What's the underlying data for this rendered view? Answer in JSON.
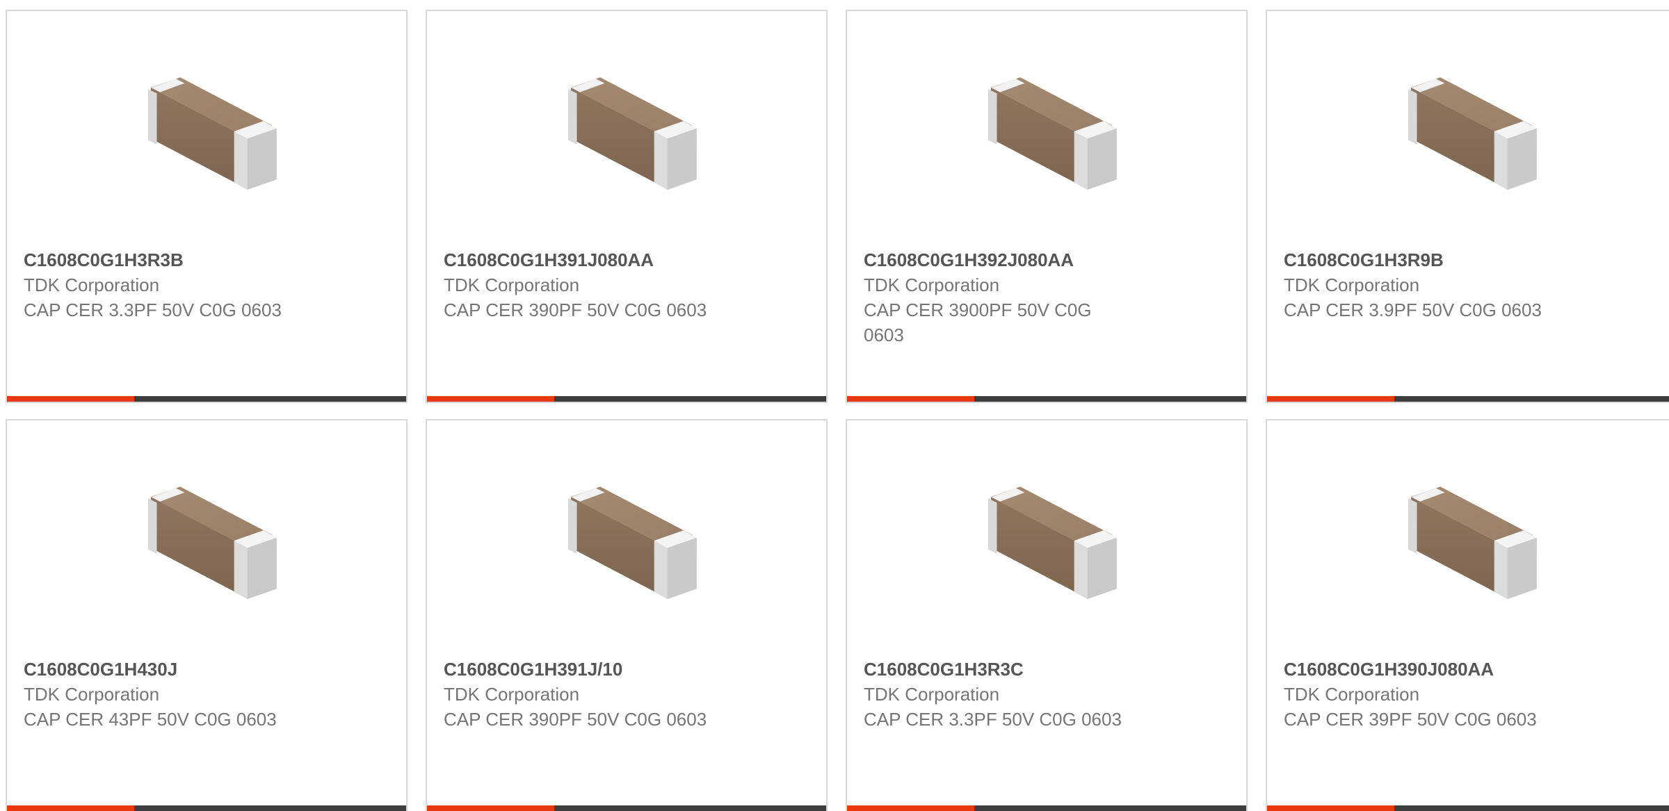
{
  "colors": {
    "accent": "#e8380d",
    "bar": "#3d3d3d",
    "border": "#d8d8d8",
    "part_text": "#555555",
    "secondary_text": "#757575"
  },
  "products": [
    {
      "part": "C1608C0G1H3R3B",
      "manufacturer": "TDK Corporation",
      "description": "CAP CER 3.3PF 50V C0G 0603",
      "image_icon": "capacitor-chip-icon"
    },
    {
      "part": "C1608C0G1H391J080AA",
      "manufacturer": "TDK Corporation",
      "description": "CAP CER 390PF 50V C0G 0603",
      "image_icon": "capacitor-chip-icon"
    },
    {
      "part": "C1608C0G1H392J080AA",
      "manufacturer": "TDK Corporation",
      "description": "CAP CER 3900PF 50V C0G 0603",
      "image_icon": "capacitor-chip-icon"
    },
    {
      "part": "C1608C0G1H3R9B",
      "manufacturer": "TDK Corporation",
      "description": "CAP CER 3.9PF 50V C0G 0603",
      "image_icon": "capacitor-chip-icon"
    },
    {
      "part": "C1608C0G1H430J",
      "manufacturer": "TDK Corporation",
      "description": "CAP CER 43PF 50V C0G 0603",
      "image_icon": "capacitor-chip-icon"
    },
    {
      "part": "C1608C0G1H391J/10",
      "manufacturer": "TDK Corporation",
      "description": "CAP CER 390PF 50V C0G 0603",
      "image_icon": "capacitor-chip-icon"
    },
    {
      "part": "C1608C0G1H3R3C",
      "manufacturer": "TDK Corporation",
      "description": "CAP CER 3.3PF 50V C0G 0603",
      "image_icon": "capacitor-chip-icon"
    },
    {
      "part": "C1608C0G1H390J080AA",
      "manufacturer": "TDK Corporation",
      "description": "CAP CER 39PF 50V C0G 0603",
      "image_icon": "capacitor-chip-icon"
    }
  ]
}
